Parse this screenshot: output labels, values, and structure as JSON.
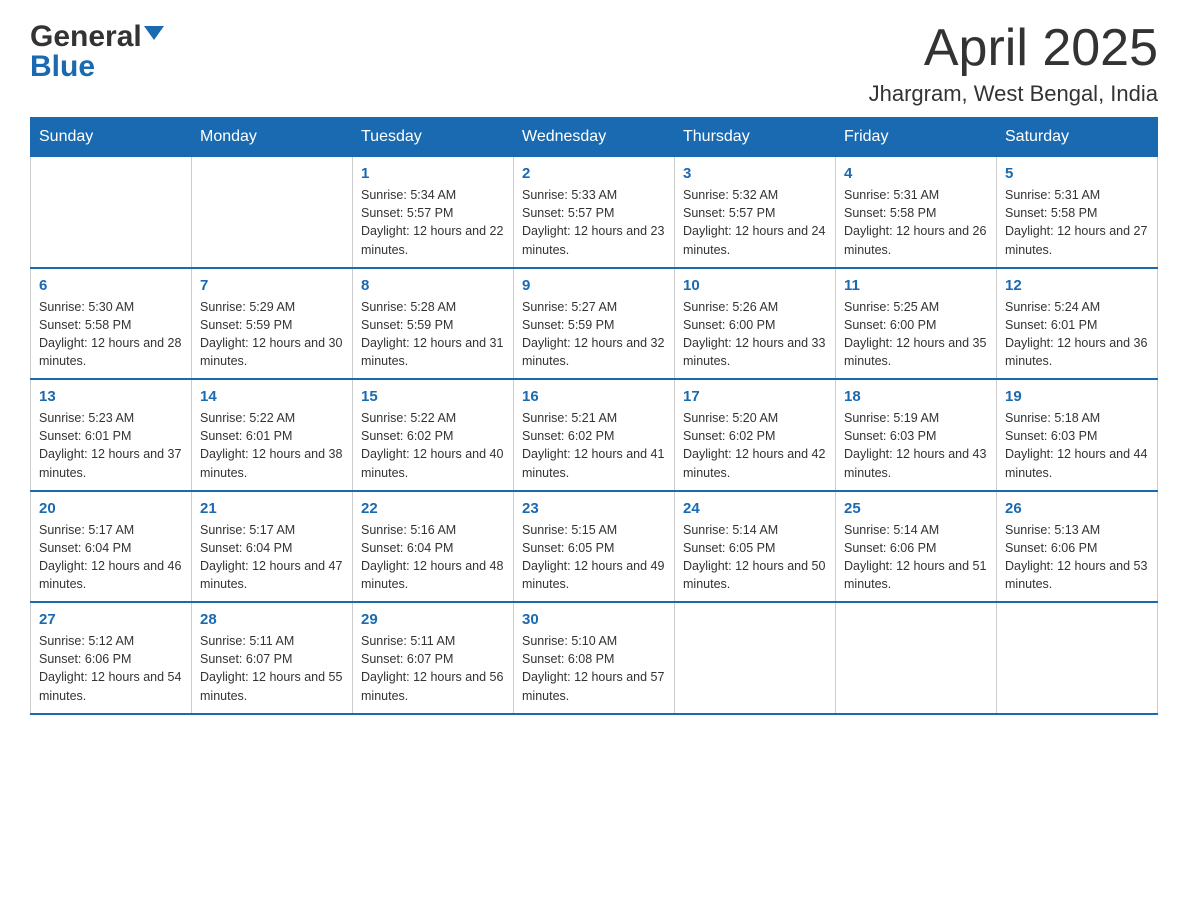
{
  "header": {
    "logo_general": "General",
    "logo_blue": "Blue",
    "month_title": "April 2025",
    "location": "Jhargram, West Bengal, India"
  },
  "weekdays": [
    "Sunday",
    "Monday",
    "Tuesday",
    "Wednesday",
    "Thursday",
    "Friday",
    "Saturday"
  ],
  "weeks": [
    [
      {
        "day": "",
        "sunrise": "",
        "sunset": "",
        "daylight": ""
      },
      {
        "day": "",
        "sunrise": "",
        "sunset": "",
        "daylight": ""
      },
      {
        "day": "1",
        "sunrise": "Sunrise: 5:34 AM",
        "sunset": "Sunset: 5:57 PM",
        "daylight": "Daylight: 12 hours and 22 minutes."
      },
      {
        "day": "2",
        "sunrise": "Sunrise: 5:33 AM",
        "sunset": "Sunset: 5:57 PM",
        "daylight": "Daylight: 12 hours and 23 minutes."
      },
      {
        "day": "3",
        "sunrise": "Sunrise: 5:32 AM",
        "sunset": "Sunset: 5:57 PM",
        "daylight": "Daylight: 12 hours and 24 minutes."
      },
      {
        "day": "4",
        "sunrise": "Sunrise: 5:31 AM",
        "sunset": "Sunset: 5:58 PM",
        "daylight": "Daylight: 12 hours and 26 minutes."
      },
      {
        "day": "5",
        "sunrise": "Sunrise: 5:31 AM",
        "sunset": "Sunset: 5:58 PM",
        "daylight": "Daylight: 12 hours and 27 minutes."
      }
    ],
    [
      {
        "day": "6",
        "sunrise": "Sunrise: 5:30 AM",
        "sunset": "Sunset: 5:58 PM",
        "daylight": "Daylight: 12 hours and 28 minutes."
      },
      {
        "day": "7",
        "sunrise": "Sunrise: 5:29 AM",
        "sunset": "Sunset: 5:59 PM",
        "daylight": "Daylight: 12 hours and 30 minutes."
      },
      {
        "day": "8",
        "sunrise": "Sunrise: 5:28 AM",
        "sunset": "Sunset: 5:59 PM",
        "daylight": "Daylight: 12 hours and 31 minutes."
      },
      {
        "day": "9",
        "sunrise": "Sunrise: 5:27 AM",
        "sunset": "Sunset: 5:59 PM",
        "daylight": "Daylight: 12 hours and 32 minutes."
      },
      {
        "day": "10",
        "sunrise": "Sunrise: 5:26 AM",
        "sunset": "Sunset: 6:00 PM",
        "daylight": "Daylight: 12 hours and 33 minutes."
      },
      {
        "day": "11",
        "sunrise": "Sunrise: 5:25 AM",
        "sunset": "Sunset: 6:00 PM",
        "daylight": "Daylight: 12 hours and 35 minutes."
      },
      {
        "day": "12",
        "sunrise": "Sunrise: 5:24 AM",
        "sunset": "Sunset: 6:01 PM",
        "daylight": "Daylight: 12 hours and 36 minutes."
      }
    ],
    [
      {
        "day": "13",
        "sunrise": "Sunrise: 5:23 AM",
        "sunset": "Sunset: 6:01 PM",
        "daylight": "Daylight: 12 hours and 37 minutes."
      },
      {
        "day": "14",
        "sunrise": "Sunrise: 5:22 AM",
        "sunset": "Sunset: 6:01 PM",
        "daylight": "Daylight: 12 hours and 38 minutes."
      },
      {
        "day": "15",
        "sunrise": "Sunrise: 5:22 AM",
        "sunset": "Sunset: 6:02 PM",
        "daylight": "Daylight: 12 hours and 40 minutes."
      },
      {
        "day": "16",
        "sunrise": "Sunrise: 5:21 AM",
        "sunset": "Sunset: 6:02 PM",
        "daylight": "Daylight: 12 hours and 41 minutes."
      },
      {
        "day": "17",
        "sunrise": "Sunrise: 5:20 AM",
        "sunset": "Sunset: 6:02 PM",
        "daylight": "Daylight: 12 hours and 42 minutes."
      },
      {
        "day": "18",
        "sunrise": "Sunrise: 5:19 AM",
        "sunset": "Sunset: 6:03 PM",
        "daylight": "Daylight: 12 hours and 43 minutes."
      },
      {
        "day": "19",
        "sunrise": "Sunrise: 5:18 AM",
        "sunset": "Sunset: 6:03 PM",
        "daylight": "Daylight: 12 hours and 44 minutes."
      }
    ],
    [
      {
        "day": "20",
        "sunrise": "Sunrise: 5:17 AM",
        "sunset": "Sunset: 6:04 PM",
        "daylight": "Daylight: 12 hours and 46 minutes."
      },
      {
        "day": "21",
        "sunrise": "Sunrise: 5:17 AM",
        "sunset": "Sunset: 6:04 PM",
        "daylight": "Daylight: 12 hours and 47 minutes."
      },
      {
        "day": "22",
        "sunrise": "Sunrise: 5:16 AM",
        "sunset": "Sunset: 6:04 PM",
        "daylight": "Daylight: 12 hours and 48 minutes."
      },
      {
        "day": "23",
        "sunrise": "Sunrise: 5:15 AM",
        "sunset": "Sunset: 6:05 PM",
        "daylight": "Daylight: 12 hours and 49 minutes."
      },
      {
        "day": "24",
        "sunrise": "Sunrise: 5:14 AM",
        "sunset": "Sunset: 6:05 PM",
        "daylight": "Daylight: 12 hours and 50 minutes."
      },
      {
        "day": "25",
        "sunrise": "Sunrise: 5:14 AM",
        "sunset": "Sunset: 6:06 PM",
        "daylight": "Daylight: 12 hours and 51 minutes."
      },
      {
        "day": "26",
        "sunrise": "Sunrise: 5:13 AM",
        "sunset": "Sunset: 6:06 PM",
        "daylight": "Daylight: 12 hours and 53 minutes."
      }
    ],
    [
      {
        "day": "27",
        "sunrise": "Sunrise: 5:12 AM",
        "sunset": "Sunset: 6:06 PM",
        "daylight": "Daylight: 12 hours and 54 minutes."
      },
      {
        "day": "28",
        "sunrise": "Sunrise: 5:11 AM",
        "sunset": "Sunset: 6:07 PM",
        "daylight": "Daylight: 12 hours and 55 minutes."
      },
      {
        "day": "29",
        "sunrise": "Sunrise: 5:11 AM",
        "sunset": "Sunset: 6:07 PM",
        "daylight": "Daylight: 12 hours and 56 minutes."
      },
      {
        "day": "30",
        "sunrise": "Sunrise: 5:10 AM",
        "sunset": "Sunset: 6:08 PM",
        "daylight": "Daylight: 12 hours and 57 minutes."
      },
      {
        "day": "",
        "sunrise": "",
        "sunset": "",
        "daylight": ""
      },
      {
        "day": "",
        "sunrise": "",
        "sunset": "",
        "daylight": ""
      },
      {
        "day": "",
        "sunrise": "",
        "sunset": "",
        "daylight": ""
      }
    ]
  ]
}
